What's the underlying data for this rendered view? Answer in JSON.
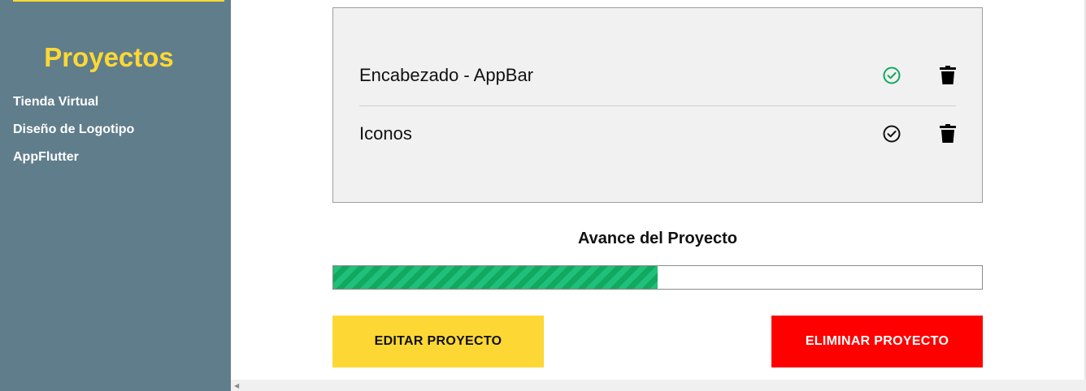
{
  "sidebar": {
    "title": "Proyectos",
    "items": [
      {
        "label": "Tienda Virtual"
      },
      {
        "label": "Diseño de Logotipo"
      },
      {
        "label": "AppFlutter"
      }
    ]
  },
  "tasks": [
    {
      "name": "Encabezado - AppBar",
      "status": "complete",
      "check_icon": "check-circle-icon",
      "check_color": "#12a85f",
      "delete_icon": "trash-icon"
    },
    {
      "name": "Iconos",
      "status": "incomplete",
      "check_icon": "check-circle-icon",
      "check_color": "#111111",
      "delete_icon": "trash-icon"
    }
  ],
  "progress": {
    "title": "Avance del Proyecto",
    "percent": 50
  },
  "buttons": {
    "edit_label": "EDITAR PROYECTO",
    "delete_label": "ELIMINAR PROYECTO"
  },
  "colors": {
    "sidebar_bg": "#607d8b",
    "accent_yellow": "#fdd835",
    "danger_red": "#ff0000",
    "progress_green": "#21c07a"
  }
}
